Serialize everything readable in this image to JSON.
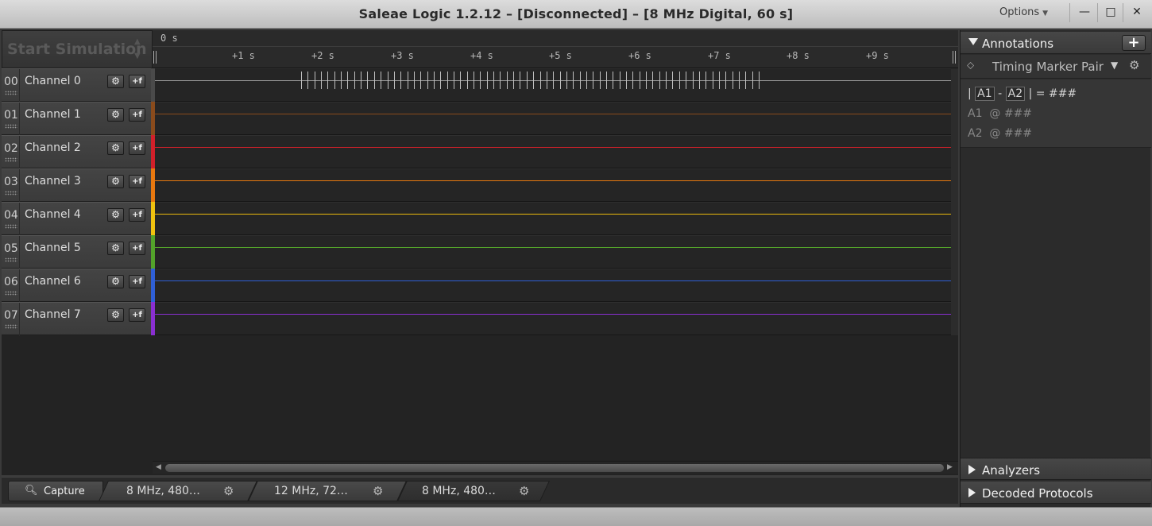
{
  "window": {
    "title": "Saleae Logic 1.2.12 – [Disconnected] – [8 MHz Digital, 60 s]",
    "options_label": "Options",
    "minimize": "—",
    "maximize": "□",
    "close": "✕"
  },
  "simulation": {
    "start_label": "Start Simulation",
    "up": "▲",
    "down": "▼"
  },
  "ruler": {
    "origin": "0 s",
    "ticks": [
      "+1 s",
      "+2 s",
      "+3 s",
      "+4 s",
      "+5 s",
      "+6 s",
      "+7 s",
      "+8 s",
      "+9 s"
    ]
  },
  "channels": [
    {
      "num": "00",
      "name": "Channel 0",
      "color": "#4a4a4a",
      "line": "#9a9a9a"
    },
    {
      "num": "01",
      "name": "Channel 1",
      "color": "#8a4b1c",
      "line": "#8a4b1c"
    },
    {
      "num": "02",
      "name": "Channel 2",
      "color": "#d1202a",
      "line": "#d1202a"
    },
    {
      "num": "03",
      "name": "Channel 3",
      "color": "#e8780f",
      "line": "#e8780f"
    },
    {
      "num": "04",
      "name": "Channel 4",
      "color": "#f0c20f",
      "line": "#e9b90c"
    },
    {
      "num": "05",
      "name": "Channel 5",
      "color": "#53a32a",
      "line": "#53a32a"
    },
    {
      "num": "06",
      "name": "Channel 6",
      "color": "#2f5fd6",
      "line": "#2f5fd6"
    },
    {
      "num": "07",
      "name": "Channel 7",
      "color": "#8a2fd1",
      "line": "#8a2fd1"
    }
  ],
  "channel_buttons": {
    "gear": "⚙",
    "trigger": "+f"
  },
  "scroll": {
    "left": "◀",
    "right": "▶"
  },
  "tabs": {
    "capture": "Capture",
    "capture_icon": "🔍︎",
    "sessions": [
      {
        "label": "8 MHz, 480…",
        "active": false
      },
      {
        "label": "12 MHz, 72…",
        "active": false
      },
      {
        "label": "8 MHz, 480…",
        "active": true
      }
    ],
    "gear": "⚙"
  },
  "annotations": {
    "title": "Annotations",
    "add": "+",
    "timing_marker": "Timing Marker Pair",
    "marker_icon": "⬦",
    "dropdown": "▼",
    "gear": "⚙",
    "diff_prefix": "|",
    "a1": "A1",
    "dash": "-",
    "a2": "A2",
    "diff_suffix": "| = ###",
    "a1_at": "@ ###",
    "a2_at": "@ ###"
  },
  "analyzers": {
    "title": "Analyzers"
  },
  "decoded": {
    "title": "Decoded Protocols"
  }
}
